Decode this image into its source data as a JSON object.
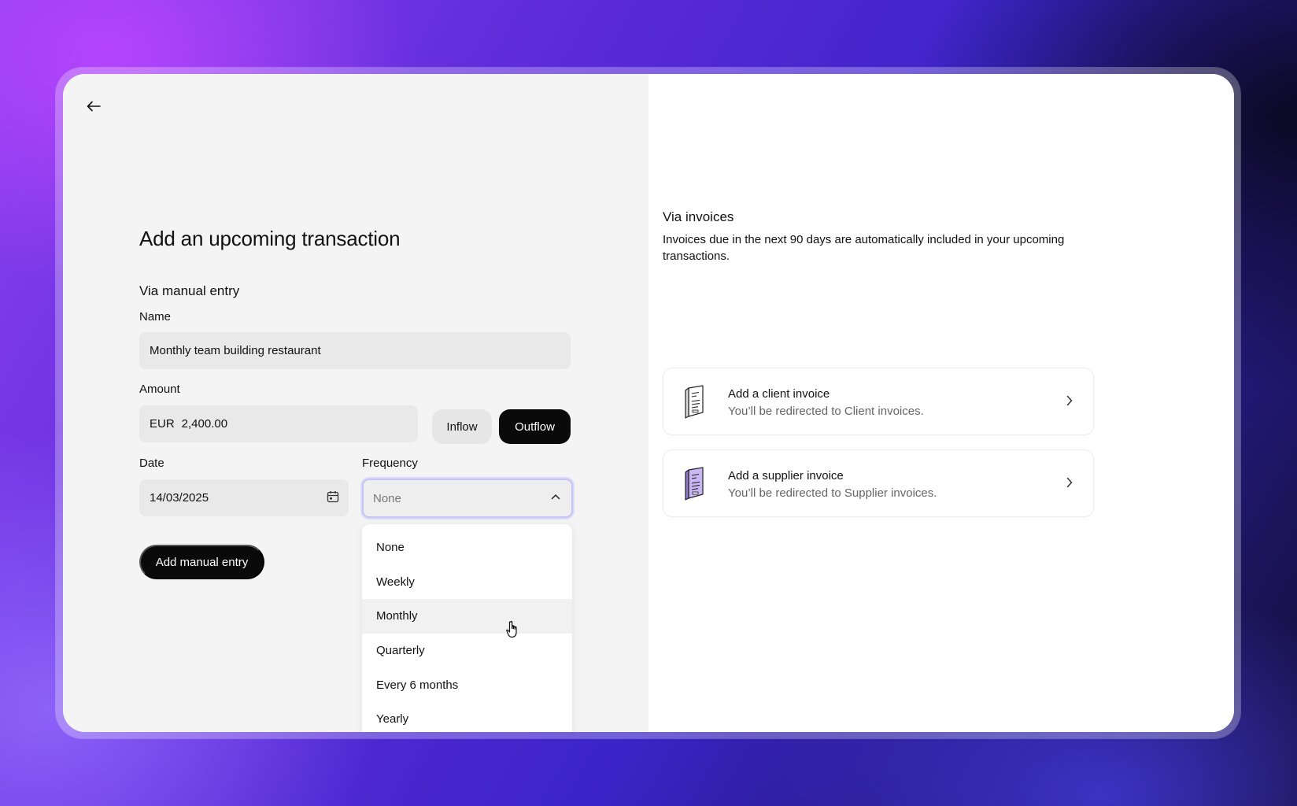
{
  "left": {
    "title": "Add an upcoming transaction",
    "section_title": "Via manual entry",
    "name": {
      "label": "Name",
      "value": "Monthly team building restaurant"
    },
    "amount": {
      "label": "Amount",
      "currency": "EUR",
      "value": "2,400.00"
    },
    "flow": {
      "inflow_label": "Inflow",
      "outflow_label": "Outflow",
      "selected": "Outflow"
    },
    "date": {
      "label": "Date",
      "value": "14/03/2025"
    },
    "frequency": {
      "label": "Frequency",
      "selected": "None",
      "options": [
        "None",
        "Weekly",
        "Monthly",
        "Quarterly",
        "Every 6 months",
        "Yearly"
      ],
      "hovered": "Monthly"
    },
    "add_button": "Add manual entry"
  },
  "right": {
    "section_title": "Via invoices",
    "description": "Invoices due in the next 90 days are automatically included in your upcoming transactions.",
    "cards": [
      {
        "title": "Add a client invoice",
        "subtitle": "You’ll be redirected to Client invoices.",
        "icon": "client-invoice-icon"
      },
      {
        "title": "Add a supplier invoice",
        "subtitle": "You’ll be redirected to Supplier invoices.",
        "icon": "supplier-invoice-icon"
      }
    ]
  },
  "colors": {
    "dark_button": "#0a0a0a",
    "focus_ring": "#c6c4f4",
    "invoice_accent": "#b8a4f0"
  }
}
